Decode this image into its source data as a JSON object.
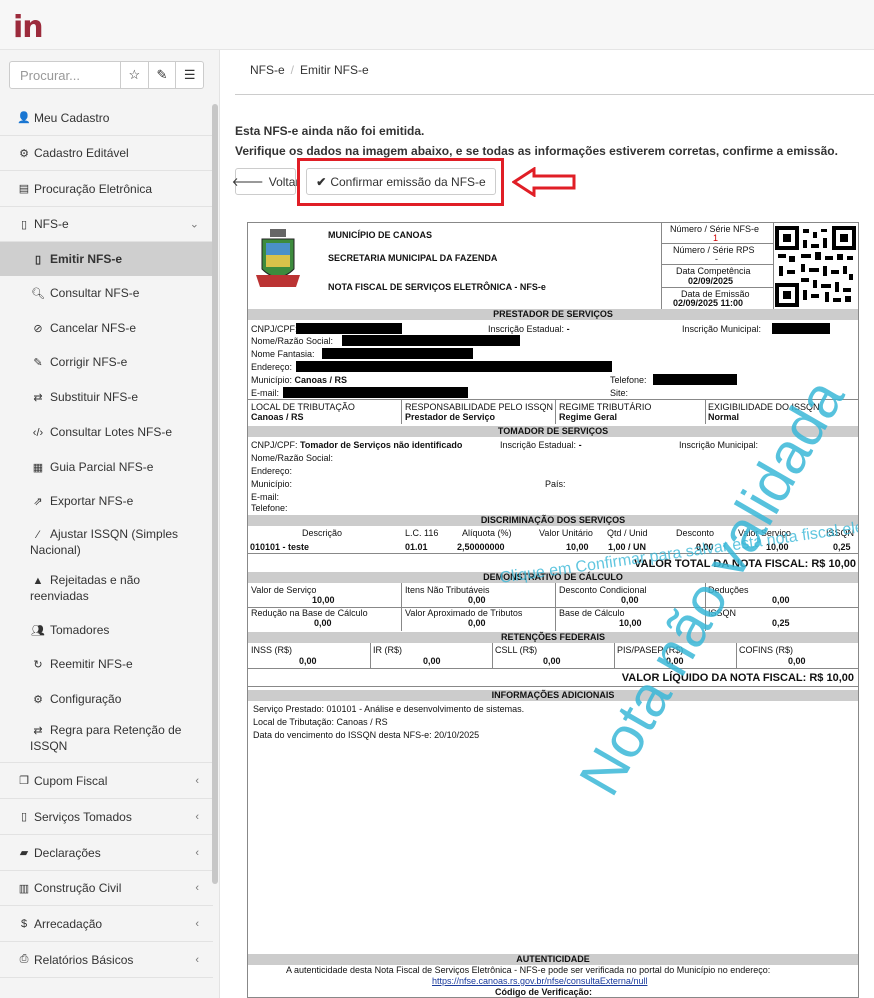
{
  "app": {
    "logo": "in"
  },
  "search": {
    "placeholder": "Procurar..."
  },
  "sidebar": {
    "items": [
      {
        "label": "Meu Cadastro",
        "icon": "user-icon"
      },
      {
        "label": "Cadastro Editável",
        "icon": "cogs-icon"
      },
      {
        "label": "Procuração Eletrônica",
        "icon": "id-card-icon"
      },
      {
        "label": "NFS-e",
        "icon": "file-icon"
      }
    ],
    "nfse_sub": [
      "Emitir NFS-e",
      "Consultar NFS-e",
      "Cancelar NFS-e",
      "Corrigir NFS-e",
      "Substituir NFS-e",
      "Consultar Lotes NFS-e",
      "Guia Parcial NFS-e",
      "Exportar NFS-e",
      "Ajustar ISSQN (Simples Nacional)",
      "Rejeitadas e não reenviadas",
      "Tomadores",
      "Reemitir NFS-e",
      "Configuração",
      "Regra para Retenção de ISSQN"
    ],
    "bottom": [
      "Cupom Fiscal",
      "Serviços Tomados",
      "Declarações",
      "Construção Civil",
      "Arrecadação",
      "Relatórios Básicos"
    ]
  },
  "breadcrumb": {
    "root": "NFS-e",
    "current": "Emitir NFS-e"
  },
  "notice": {
    "line1": "Esta NFS-e ainda não foi emitida.",
    "line2": "Verifique os dados na imagem abaixo, e se todas as informações estiverem corretas, confirme a emissão."
  },
  "buttons": {
    "back": "Voltar",
    "confirm": "Confirmar emissão da NFS-e"
  },
  "nota": {
    "municipio": "MUNICÍPIO DE CANOAS",
    "secretaria": "SECRETARIA MUNICIPAL DA FAZENDA",
    "titulo": "NOTA FISCAL DE SERVIÇOS ELETRÔNICA - NFS-e",
    "numero_label": "Número / Série NFS-e",
    "numero_value": "1",
    "rps_label": "Número / Série RPS",
    "rps_value": "-",
    "competencia_label": "Data Competência",
    "competencia_value": "02/09/2025",
    "emissao_label": "Data de Emissão",
    "emissao_value": "02/09/2025 11:00",
    "prestador_header": "PRESTADOR DE SERVIÇOS",
    "cnpj_label": "CNPJ/CPF:",
    "ie_label": "Inscrição Estadual:",
    "ie_value": "-",
    "im_label": "Inscrição Municipal:",
    "razao_label": "Nome/Razão Social:",
    "fantasia_label": "Nome Fantasia:",
    "endereco_label": "Endereço:",
    "municipio_label": "Município:",
    "municipio_value": "Canoas / RS",
    "telefone_label": "Telefone:",
    "email_label": "E-mail:",
    "site_label": "Site:",
    "local_trib_label": "LOCAL DE TRIBUTAÇÃO",
    "local_trib_value": "Canoas / RS",
    "resp_label": "RESPONSABILIDADE PELO ISSQN",
    "resp_value": "Prestador de Serviço",
    "regime_label": "REGIME TRIBUTÁRIO",
    "regime_value": "Regime Geral",
    "exig_label": "EXIGIBILIDADE DO ISSQN",
    "exig_value": "Normal",
    "tomador_header": "TOMADOR DE SERVIÇOS",
    "tomador_cnpj_value": "Tomador de Serviços não identificado",
    "tomador_ie_value": "-",
    "pais_label": "País:",
    "discr_header": "DISCRIMINAÇÃO DOS SERVIÇOS",
    "col_descricao": "Descrição",
    "col_lc": "L.C. 116",
    "col_aliquota": "Alíquota (%)",
    "col_valor_unit": "Valor Unitário",
    "col_qtd": "Qtd / Unid",
    "col_desconto": "Desconto",
    "col_valor_serv": "Valor Serviço",
    "col_issqn": "ISSQN",
    "item_descricao": "010101 - teste",
    "item_lc": "01.01",
    "item_aliquota": "2,50000000",
    "item_valor_unit": "10,00",
    "item_qtd": "1,00 / UN",
    "item_desconto": "0,00",
    "item_valor_serv": "10,00",
    "item_issqn": "0,25",
    "total_label": "VALOR TOTAL DA NOTA FISCAL: R$ 10,00",
    "demo_header": "DEMONSTRATIVO DE CÁLCULO",
    "d_valor_serv_label": "Valor de Serviço",
    "d_valor_serv": "10,00",
    "d_itens_label": "Itens Não Tributáveis",
    "d_itens": "0,00",
    "d_desc_cond_label": "Desconto Condicional",
    "d_desc_cond": "0,00",
    "d_deducoes_label": "Deduções",
    "d_deducoes": "0,00",
    "d_reducao_label": "Redução na Base de Cálculo",
    "d_reducao": "0,00",
    "d_aprox_label": "Valor Aproximado de Tributos",
    "d_aprox": "0,00",
    "d_base_label": "Base de Cálculo",
    "d_base": "10,00",
    "d_issqn_label": "ISSQN",
    "d_issqn": "0,25",
    "ret_header": "RETENÇÕES FEDERAIS",
    "r_inss_label": "INSS (R$)",
    "r_inss": "0,00",
    "r_ir_label": "IR (R$)",
    "r_ir": "0,00",
    "r_csll_label": "CSLL (R$)",
    "r_csll": "0,00",
    "r_pis_label": "PIS/PASEP (R$)",
    "r_pis": "0,00",
    "r_cofins_label": "COFINS (R$)",
    "r_cofins": "0,00",
    "liquido_label": "VALOR LÍQUIDO DA NOTA FISCAL: R$ 10,00",
    "info_header": "INFORMAÇÕES ADICIONAIS",
    "info1": "Serviço Prestado: 010101 - Análise e desenvolvimento de sistemas.",
    "info2": "Local de Tributação: Canoas / RS",
    "info3": "Data do vencimento do ISSQN desta NFS-e: 20/10/2025",
    "aut_header": "AUTENTICIDADE",
    "aut_text": "A autenticidade desta Nota Fiscal de Serviços Eletrônica - NFS-e pode ser verificada no portal do Município no endereço:",
    "aut_url": "https://nfse.canoas.rs.gov.br/nfse/consultaExterna/null",
    "aut_code_label": "Código de Verificação:",
    "watermark": "Nota não validada",
    "watermark2": "Clique em Confirmar para salvar esta nota fiscal eletrônica"
  }
}
